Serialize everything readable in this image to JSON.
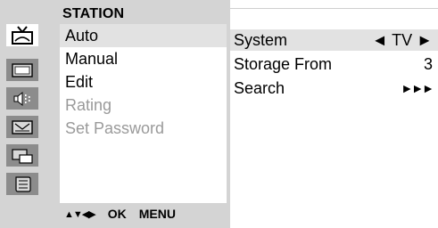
{
  "osd": {
    "title": "STATION",
    "icons": [
      "antenna-icon",
      "picture-icon",
      "sound-icon",
      "teletext-icon",
      "pip-icon",
      "setup-icon"
    ],
    "menu_items": [
      {
        "label": "Auto",
        "state": "selected"
      },
      {
        "label": "Manual",
        "state": "normal"
      },
      {
        "label": "Edit",
        "state": "normal"
      },
      {
        "label": "Rating",
        "state": "disabled"
      },
      {
        "label": "Set Password",
        "state": "disabled"
      }
    ],
    "footer": {
      "nav_arrows": "▲▼◀▶",
      "ok_label": "OK",
      "menu_label": "MENU"
    }
  },
  "settings": {
    "rows": [
      {
        "label": "System",
        "value": "◄ TV ►"
      },
      {
        "label": "Storage From",
        "value": "3"
      },
      {
        "label": "Search",
        "value": "►►►"
      }
    ]
  },
  "colors": {
    "panel_bg": "#d4d4d4",
    "icon_bg": "#8c8c8c",
    "highlight": "#e2e2e2",
    "disabled_text": "#9a9a9a"
  }
}
